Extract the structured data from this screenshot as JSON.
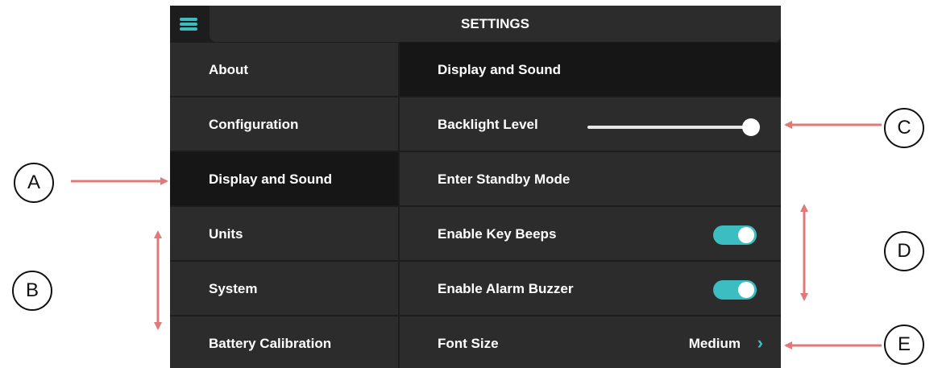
{
  "header": {
    "title": "SETTINGS"
  },
  "left_menu": {
    "items": [
      {
        "label": "About"
      },
      {
        "label": "Configuration"
      },
      {
        "label": "Display and Sound",
        "selected": true
      },
      {
        "label": "Units"
      },
      {
        "label": "System"
      },
      {
        "label": "Battery Calibration"
      }
    ]
  },
  "right_panel": {
    "title": "Display and Sound",
    "backlight": {
      "label": "Backlight Level",
      "level": 1.0
    },
    "standby": {
      "label": "Enter Standby Mode"
    },
    "key_beeps": {
      "label": "Enable Key Beeps",
      "enabled": true
    },
    "alarm_buzzer": {
      "label": "Enable Alarm Buzzer",
      "enabled": true
    },
    "font_size": {
      "label": "Font Size",
      "value": "Medium"
    }
  },
  "callouts": {
    "a": "A",
    "b": "B",
    "c": "C",
    "d": "D",
    "e": "E"
  },
  "colors": {
    "accent": "#3bbdc1",
    "arrow": "#e07a7a",
    "panel": "#2c2c2c",
    "panel_dark": "#161616"
  },
  "icons": [
    "hamburger-menu-icon",
    "chevron-right-icon"
  ]
}
